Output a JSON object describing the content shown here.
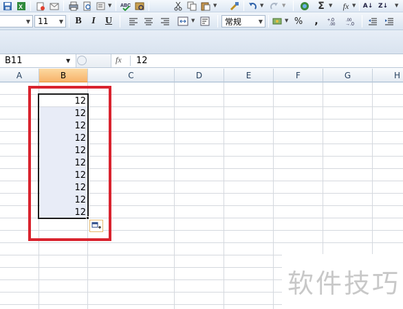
{
  "toolbar": {
    "font_size": "11",
    "bold_label": "B",
    "italic_label": "I",
    "underline_label": "U",
    "number_format": "常规",
    "percent_label": "%",
    "comma_label": ","
  },
  "formula_bar": {
    "name_box": "B11",
    "fx_label": "fx",
    "formula": "12"
  },
  "columns": [
    "A",
    "B",
    "C",
    "D",
    "E",
    "F",
    "G",
    "H"
  ],
  "selected_column": "B",
  "cells": {
    "b2": "12",
    "b3": "12",
    "b4": "12",
    "b5": "12",
    "b6": "12",
    "b7": "12",
    "b8": "12",
    "b9": "12",
    "b10": "12",
    "b11": "12"
  },
  "watermark": "软件技巧",
  "colors": {
    "highlight": "#d9232e",
    "selected_header": "#f7b36a",
    "selection_fill": "#e8ecf7"
  }
}
